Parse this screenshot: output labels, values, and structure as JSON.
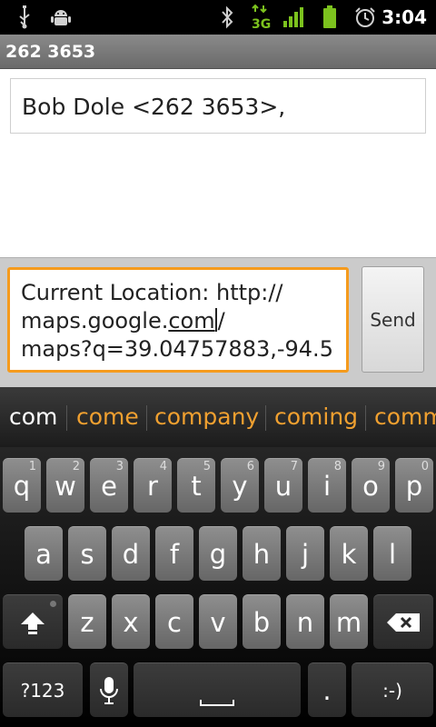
{
  "status_bar": {
    "icons": [
      "usb-icon",
      "android-debug-icon",
      "bluetooth-icon",
      "3g-data-icon",
      "signal-icon",
      "battery-icon",
      "alarm-icon"
    ],
    "network_label": "3G",
    "time": "3:04"
  },
  "title_bar": {
    "title": "262 3653"
  },
  "recipients": {
    "value": "Bob Dole <262 3653>,"
  },
  "message": {
    "line1": "Current Location: http://",
    "line2_prefix": "maps.google.",
    "line2_underlined": "com",
    "line2_suffix": "/",
    "line3": "maps?q=39.04757883,-94.5",
    "highlight_color": "#f59b1d"
  },
  "send_button": {
    "label": "Send"
  },
  "suggestions": {
    "typed": "com",
    "items": [
      "come",
      "company",
      "coming",
      "comm"
    ],
    "color": "#f0a030"
  },
  "keyboard": {
    "row1": [
      {
        "label": "q",
        "hint": "1"
      },
      {
        "label": "w",
        "hint": "2"
      },
      {
        "label": "e",
        "hint": "3"
      },
      {
        "label": "r",
        "hint": "4"
      },
      {
        "label": "t",
        "hint": "5"
      },
      {
        "label": "y",
        "hint": "6"
      },
      {
        "label": "u",
        "hint": "7"
      },
      {
        "label": "i",
        "hint": "8"
      },
      {
        "label": "o",
        "hint": "9"
      },
      {
        "label": "p",
        "hint": "0"
      }
    ],
    "row2": [
      "a",
      "s",
      "d",
      "f",
      "g",
      "h",
      "j",
      "k",
      "l"
    ],
    "row3": [
      "z",
      "x",
      "c",
      "v",
      "b",
      "n",
      "m"
    ],
    "symbols_label": "?123",
    "period_label": ".",
    "smiley_label": ":-)",
    "shift_icon": "shift-icon",
    "backspace_icon": "backspace-icon",
    "mic_icon": "microphone-icon",
    "space_icon": "space-bar-icon"
  }
}
